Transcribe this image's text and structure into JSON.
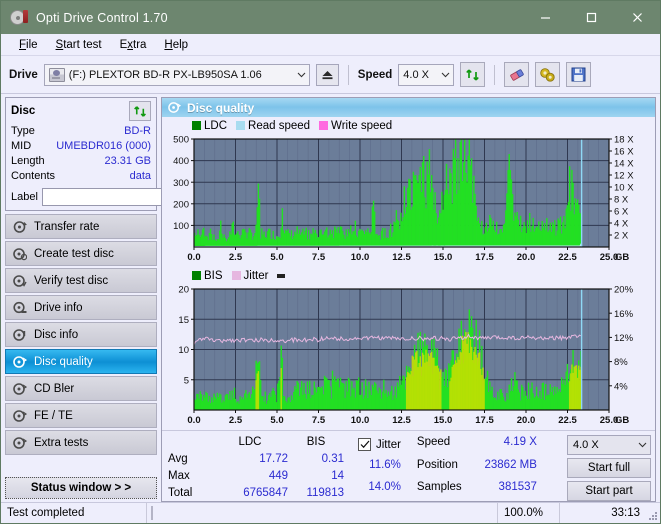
{
  "window": {
    "title": "Opti Drive Control 1.70",
    "icon": "disc-icon",
    "minimize_label": "—",
    "maximize_label": "☐",
    "close_label": "✕",
    "titlebar_color": "#6d866f"
  },
  "menu": [
    {
      "label": "File",
      "accel": "F"
    },
    {
      "label": "Start test",
      "accel": "S"
    },
    {
      "label": "Extra",
      "accel": "x"
    },
    {
      "label": "Help",
      "accel": "H"
    }
  ],
  "toolbar": {
    "drive_label": "Drive",
    "drive_value": "(F:)  PLEXTOR BD-R  PX-LB950SA 1.06",
    "eject_icon": "eject-icon",
    "speed_label": "Speed",
    "speed_value": "4.0 X",
    "refresh_icon": "refresh-icon",
    "erase_icon": "eraser-icon",
    "settings_icon": "gears-icon",
    "save_icon": "save-icon",
    "chevron": "⌄"
  },
  "sidebar": {
    "disc_panel": {
      "title": "Disc",
      "refresh_icon": "refresh-icon",
      "rows": [
        {
          "key": "Type",
          "value": "BD-R"
        },
        {
          "key": "MID",
          "value": "UMEBDR016 (000)"
        },
        {
          "key": "Length",
          "value": "23.31 GB"
        },
        {
          "key": "Contents",
          "value": "data"
        }
      ],
      "label_key": "Label",
      "label_value": "",
      "label_placeholder": "",
      "label_button_icon": "disc-icon"
    },
    "items": [
      {
        "label": "Transfer rate",
        "icon": "disc-transfer-icon",
        "active": false
      },
      {
        "label": "Create test disc",
        "icon": "disc-create-icon",
        "active": false
      },
      {
        "label": "Verify test disc",
        "icon": "disc-verify-icon",
        "active": false
      },
      {
        "label": "Drive info",
        "icon": "disc-drive-icon",
        "active": false
      },
      {
        "label": "Disc info",
        "icon": "disc-info-icon",
        "active": false
      },
      {
        "label": "Disc quality",
        "icon": "disc-quality-icon",
        "active": true
      },
      {
        "label": "CD Bler",
        "icon": "disc-bler-icon",
        "active": false
      },
      {
        "label": "FE / TE",
        "icon": "disc-fete-icon",
        "active": false
      },
      {
        "label": "Extra tests",
        "icon": "disc-extra-icon",
        "active": false
      }
    ],
    "status_window_button": "Status window > >"
  },
  "main": {
    "header_title": "Disc quality",
    "header_icon": "disc-quality-icon"
  },
  "stats": {
    "col_ldc": "LDC",
    "col_bis": "BIS",
    "rows": [
      {
        "label": "Avg",
        "ldc": "17.72",
        "bis": "0.31",
        "jitter": "11.6%"
      },
      {
        "label": "Max",
        "ldc": "449",
        "bis": "14",
        "jitter": "14.0%"
      },
      {
        "label": "Total",
        "ldc": "6765847",
        "bis": "119813",
        "jitter": ""
      }
    ],
    "jitter_label": "Jitter",
    "jitter_checked": true,
    "speed_label": "Speed",
    "speed_value": "4.19 X",
    "position_label": "Position",
    "position_value": "23862 MB",
    "samples_label": "Samples",
    "samples_value": "381537",
    "speed_select": "4.0 X",
    "start_full": "Start full",
    "start_part": "Start part",
    "chevron": "⌄"
  },
  "statusbar": {
    "message": "Test completed",
    "progress_pct": 100.0,
    "progress_text": "100.0%",
    "elapsed": "33:13"
  },
  "colors": {
    "ldc_green": "#00e000",
    "read_speed": "#a8dcf0",
    "write_speed": "#ff6ae0",
    "jitter_pink": "#e6b7e0",
    "bis_yellow": "#c8e000",
    "plot_bg": "#6b7d99",
    "grid": "#4a5570",
    "accent_blue": "#2b2bd0",
    "progress_green": "#00a500"
  },
  "chart_data": [
    {
      "type": "area",
      "name": "disc-quality-ldc",
      "title": "",
      "xlabel": "GB",
      "ylabel": "",
      "xlim": [
        0,
        25
      ],
      "xticks": [
        "0.0",
        "2.5",
        "5.0",
        "7.5",
        "10.0",
        "12.5",
        "15.0",
        "17.5",
        "20.0",
        "22.5",
        "25.0"
      ],
      "ylim": [
        0,
        500
      ],
      "yticks": [
        100,
        200,
        300,
        400,
        500
      ],
      "y2lim": [
        0,
        18
      ],
      "y2ticks": [
        "2 X",
        "4 X",
        "6 X",
        "8 X",
        "10 X",
        "12 X",
        "14 X",
        "16 X",
        "18 X"
      ],
      "grid": true,
      "legend": [
        {
          "label": "LDC",
          "color": "#00a000"
        },
        {
          "label": "Read speed",
          "color": "#a8dcf0"
        },
        {
          "label": "Write speed",
          "color": "#ff6ae0"
        }
      ],
      "series": [
        {
          "name": "LDC",
          "kind": "area",
          "color": "#22e022",
          "x": [
            0.0,
            0.2,
            0.4,
            0.6,
            0.8,
            1.0,
            1.2,
            1.4,
            1.6,
            1.8,
            2.0,
            2.2,
            2.4,
            2.6,
            2.8,
            3.0,
            3.2,
            3.4,
            3.6,
            3.8,
            3.9,
            4.0,
            4.2,
            4.4,
            4.6,
            4.8,
            5.0,
            5.2,
            5.35,
            5.4,
            5.6,
            5.8,
            6.0,
            6.2,
            6.4,
            6.6,
            6.8,
            7.0,
            7.2,
            7.4,
            7.6,
            7.8,
            8.0,
            8.2,
            8.4,
            8.6,
            8.8,
            9.0,
            9.2,
            9.4,
            9.6,
            9.8,
            10.0,
            10.2,
            10.4,
            10.6,
            10.8,
            11.0,
            11.2,
            11.4,
            11.6,
            11.8,
            12.0,
            12.2,
            12.4,
            12.6,
            12.8,
            13.0,
            13.2,
            13.4,
            13.6,
            13.8,
            14.0,
            14.2,
            14.4,
            14.6,
            14.8,
            15.0,
            15.2,
            15.4,
            15.6,
            15.8,
            16.0,
            16.2,
            16.4,
            16.6,
            16.8,
            17.0,
            17.2,
            17.4,
            17.6,
            17.8,
            18.0,
            18.2,
            18.4,
            18.6,
            18.8,
            19.0,
            19.2,
            19.4,
            19.6,
            19.8,
            20.0,
            20.2,
            20.4,
            20.6,
            20.8,
            21.0,
            21.2,
            21.4,
            21.6,
            21.8,
            22.0,
            22.2,
            22.4,
            22.6,
            22.8,
            23.0,
            23.2,
            23.35
          ],
          "y": [
            45,
            65,
            50,
            85,
            55,
            60,
            45,
            50,
            70,
            55,
            45,
            60,
            95,
            50,
            55,
            60,
            50,
            60,
            55,
            95,
            385,
            70,
            55,
            60,
            65,
            55,
            50,
            60,
            325,
            70,
            60,
            55,
            60,
            70,
            55,
            60,
            65,
            55,
            70,
            60,
            65,
            55,
            70,
            60,
            75,
            60,
            70,
            65,
            60,
            75,
            65,
            60,
            70,
            65,
            75,
            60,
            160,
            70,
            60,
            75,
            65,
            80,
            60,
            150,
            130,
            200,
            250,
            290,
            320,
            280,
            250,
            300,
            260,
            330,
            240,
            150,
            120,
            210,
            300,
            260,
            330,
            420,
            380,
            450,
            430,
            390,
            300,
            180,
            120,
            100,
            90,
            110,
            95,
            85,
            100,
            90,
            120,
            360,
            180,
            130,
            110,
            95,
            90,
            120,
            100,
            85,
            95,
            110,
            90,
            100,
            95,
            85,
            110,
            90,
            130,
            270,
            250,
            270,
            140,
            100
          ]
        },
        {
          "name": "Read speed",
          "kind": "line",
          "color": "#bfe6f7",
          "x": [
            0.0,
            1.0,
            2.0,
            3.0,
            4.0,
            5.0,
            6.0,
            7.0,
            8.0,
            9.0,
            10.0,
            11.0,
            12.0,
            13.0,
            14.0,
            15.0,
            16.0,
            17.0,
            18.0,
            19.0,
            20.0,
            21.0,
            22.0,
            23.0,
            23.3,
            23.35
          ],
          "y": [
            1.8,
            2.0,
            2.2,
            2.4,
            2.5,
            2.6,
            2.7,
            2.85,
            3.0,
            3.1,
            3.2,
            3.3,
            3.4,
            3.5,
            3.6,
            3.65,
            3.7,
            3.8,
            3.9,
            3.95,
            4.0,
            4.05,
            4.1,
            4.15,
            4.2,
            18.0
          ]
        }
      ]
    },
    {
      "type": "area",
      "name": "disc-quality-bis-jitter",
      "title": "",
      "xlabel": "GB",
      "ylabel": "",
      "xlim": [
        0,
        25
      ],
      "xticks": [
        "0.0",
        "2.5",
        "5.0",
        "7.5",
        "10.0",
        "12.5",
        "15.0",
        "17.5",
        "20.0",
        "22.5",
        "25.0"
      ],
      "ylim": [
        0,
        20
      ],
      "yticks": [
        5,
        10,
        15,
        20
      ],
      "y2lim": [
        0,
        20
      ],
      "y2ticks": [
        "4%",
        "8%",
        "12%",
        "16%",
        "20%"
      ],
      "grid": true,
      "legend": [
        {
          "label": "BIS",
          "color": "#00a000"
        },
        {
          "label": "Jitter",
          "color": "#e6b7e0"
        }
      ],
      "series": [
        {
          "name": "BIS",
          "kind": "area",
          "color": "#22e022",
          "x": [
            0.0,
            0.3,
            0.6,
            0.9,
            1.2,
            1.5,
            1.8,
            2.1,
            2.4,
            2.7,
            3.0,
            3.3,
            3.6,
            3.85,
            4.1,
            4.4,
            4.7,
            5.0,
            5.3,
            5.35,
            5.6,
            5.9,
            6.2,
            6.5,
            6.8,
            7.1,
            7.4,
            7.7,
            8.0,
            8.3,
            8.6,
            8.9,
            9.2,
            9.5,
            9.8,
            10.1,
            10.4,
            10.7,
            11.0,
            11.3,
            11.6,
            11.9,
            12.2,
            12.5,
            12.8,
            13.1,
            13.4,
            13.7,
            14.0,
            14.3,
            14.6,
            14.9,
            15.2,
            15.5,
            15.8,
            16.1,
            16.3,
            16.6,
            16.9,
            17.2,
            17.5,
            17.8,
            18.1,
            18.4,
            18.7,
            19.0,
            19.3,
            19.6,
            19.9,
            20.2,
            20.5,
            20.8,
            21.1,
            21.4,
            21.7,
            22.0,
            22.3,
            22.6,
            22.9,
            23.1,
            23.3,
            23.35
          ],
          "y": [
            3.0,
            2.2,
            2.6,
            2.0,
            2.4,
            1.9,
            2.5,
            2.1,
            2.7,
            2.0,
            2.3,
            2.5,
            3.5,
            8.0,
            2.3,
            2.0,
            2.6,
            2.2,
            8.2,
            3.0,
            2.1,
            2.5,
            3.2,
            3.4,
            3.6,
            3.3,
            3.5,
            3.8,
            4.2,
            3.6,
            3.9,
            3.5,
            3.8,
            3.6,
            4.0,
            3.7,
            3.5,
            3.9,
            3.4,
            3.6,
            3.3,
            3.0,
            3.2,
            4.5,
            6.0,
            8.0,
            9.5,
            9.2,
            10.0,
            9.0,
            7.5,
            6.0,
            5.5,
            6.5,
            8.0,
            10.5,
            13.8,
            11.0,
            10.5,
            9.0,
            6.0,
            3.5,
            2.6,
            3.0,
            2.4,
            3.2,
            4.5,
            3.0,
            2.6,
            3.4,
            2.8,
            3.0,
            3.3,
            2.9,
            3.2,
            3.6,
            4.8,
            6.0,
            7.8,
            6.5,
            7.0,
            5.5
          ]
        },
        {
          "name": "Jitter",
          "kind": "line",
          "color": "#e6b7e0",
          "x": [
            0.0,
            0.5,
            1.0,
            1.5,
            2.0,
            2.5,
            3.0,
            3.5,
            4.0,
            4.5,
            5.0,
            5.5,
            6.0,
            6.5,
            7.0,
            7.5,
            8.0,
            8.5,
            9.0,
            9.5,
            10.0,
            10.5,
            11.0,
            11.5,
            12.0,
            12.5,
            13.0,
            13.5,
            14.0,
            14.5,
            15.0,
            15.5,
            16.0,
            16.5,
            17.0,
            17.5,
            18.0,
            18.5,
            19.0,
            19.5,
            20.0,
            20.5,
            21.0,
            21.5,
            22.0,
            22.5,
            23.0,
            23.3
          ],
          "y": [
            10.9,
            11.9,
            11.6,
            11.4,
            11.6,
            11.5,
            11.6,
            11.4,
            11.6,
            11.5,
            11.6,
            11.4,
            11.6,
            11.5,
            11.7,
            11.6,
            12.0,
            11.7,
            11.8,
            11.7,
            11.9,
            11.8,
            12.0,
            11.8,
            11.9,
            11.7,
            11.8,
            11.9,
            11.7,
            11.9,
            11.8,
            11.7,
            11.9,
            12.2,
            11.9,
            11.8,
            12.0,
            11.9,
            12.0,
            11.8,
            12.0,
            11.9,
            11.8,
            12.0,
            11.9,
            12.0,
            12.1,
            12.1
          ]
        }
      ]
    }
  ]
}
